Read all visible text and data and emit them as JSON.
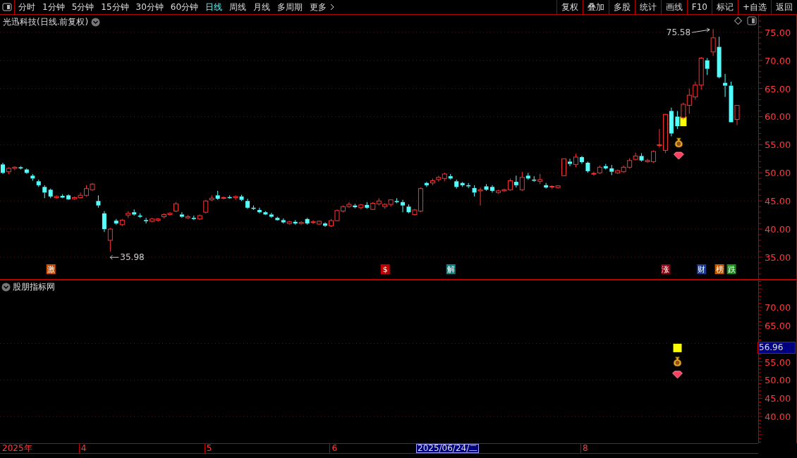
{
  "toolbar": {
    "periods": [
      {
        "label": "分时",
        "selected": false
      },
      {
        "label": "1分钟",
        "selected": false
      },
      {
        "label": "5分钟",
        "selected": false
      },
      {
        "label": "15分钟",
        "selected": false
      },
      {
        "label": "30分钟",
        "selected": false
      },
      {
        "label": "60分钟",
        "selected": false
      },
      {
        "label": "日线",
        "selected": true
      },
      {
        "label": "周线",
        "selected": false
      },
      {
        "label": "月线",
        "selected": false
      },
      {
        "label": "多周期",
        "selected": false
      },
      {
        "label": "更多",
        "selected": false
      }
    ],
    "buttons": [
      "复权",
      "叠加",
      "多股",
      "统计",
      "画线",
      "F10",
      "标记",
      "+自选",
      "返回"
    ]
  },
  "main_pane": {
    "title": "光迅科技(日线.前复权)",
    "event_tags": [
      {
        "color": "#c84a00"
      },
      {
        "color": "#c00000"
      },
      {
        "color": "#0a8080"
      },
      {
        "color": "#8a0010"
      },
      {
        "color": "#1a3a8a"
      },
      {
        "color": "#c05a00"
      },
      {
        "color": "#1a8a1a"
      }
    ],
    "chart_data": {
      "type": "candlestick",
      "grid": true,
      "ylim": [
        31,
        78.1
      ],
      "categories": [
        null,
        null,
        null,
        null,
        null,
        null,
        null,
        null,
        "激",
        null,
        null,
        null,
        null,
        null,
        null,
        null,
        null,
        null,
        null,
        null,
        null,
        null,
        null,
        null,
        null,
        null,
        null,
        null,
        null,
        null,
        null,
        null,
        null,
        null,
        null,
        null,
        null,
        null,
        null,
        null,
        null,
        null,
        null,
        null,
        null,
        null,
        null,
        null,
        null,
        null,
        null,
        null,
        null,
        null,
        null,
        null,
        null,
        null,
        null,
        null,
        null,
        null,
        null,
        null,
        "$",
        null,
        null,
        null,
        null,
        null,
        null,
        null,
        null,
        null,
        null,
        "解",
        null,
        null,
        null,
        null,
        null,
        null,
        null,
        null,
        null,
        null,
        null,
        null,
        null,
        null,
        null,
        null,
        null,
        null,
        null,
        null,
        null,
        null,
        null,
        null,
        null,
        null,
        null,
        null,
        null,
        null,
        null,
        null,
        null,
        null,
        null,
        "涨",
        null,
        null,
        null,
        null,
        null,
        "财",
        null,
        null,
        "榜",
        null,
        "跌",
        null
      ],
      "ohlc": [
        [
          51.5,
          51.8,
          49.8,
          50.0
        ],
        [
          50.2,
          51.0,
          49.8,
          50.8
        ],
        [
          50.8,
          51.2,
          50.5,
          51.0
        ],
        [
          51.0,
          51.2,
          50.6,
          50.8
        ],
        [
          50.6,
          50.8,
          49.8,
          50.0
        ],
        [
          49.5,
          49.8,
          48.6,
          49.0
        ],
        [
          48.5,
          48.8,
          47.5,
          47.8
        ],
        [
          47.5,
          47.8,
          45.5,
          46.5
        ],
        [
          47.0,
          47.2,
          45.5,
          45.8
        ],
        [
          45.6,
          46.0,
          45.4,
          45.8
        ],
        [
          45.9,
          46.2,
          45.5,
          45.6
        ],
        [
          46.0,
          46.2,
          45.2,
          45.3
        ],
        [
          45.4,
          45.8,
          45.2,
          45.6
        ],
        [
          45.6,
          46.5,
          45.5,
          46.0
        ],
        [
          46.0,
          47.8,
          45.8,
          47.2
        ],
        [
          47.0,
          48.2,
          46.8,
          48.0
        ],
        [
          45.0,
          46.0,
          43.8,
          44.2
        ],
        [
          42.8,
          43.2,
          39.5,
          40.0
        ],
        [
          38.0,
          40.2,
          35.98,
          40.0
        ],
        [
          41.5,
          41.8,
          40.8,
          41.0
        ],
        [
          40.8,
          41.8,
          40.5,
          41.6
        ],
        [
          42.5,
          43.2,
          42.0,
          42.8
        ],
        [
          43.0,
          43.5,
          42.4,
          42.6
        ],
        [
          42.4,
          42.8,
          42.0,
          42.2
        ],
        [
          41.6,
          42.0,
          41.0,
          41.4
        ],
        [
          41.4,
          42.0,
          41.2,
          41.8
        ],
        [
          41.6,
          42.0,
          41.3,
          41.8
        ],
        [
          42.2,
          42.8,
          42.0,
          42.6
        ],
        [
          42.6,
          43.0,
          42.4,
          42.8
        ],
        [
          43.2,
          44.8,
          43.0,
          44.5
        ],
        [
          42.6,
          43.0,
          42.0,
          42.2
        ],
        [
          42.0,
          42.5,
          41.8,
          42.2
        ],
        [
          42.0,
          42.4,
          41.6,
          41.8
        ],
        [
          41.8,
          42.6,
          41.6,
          42.4
        ],
        [
          43.0,
          45.2,
          42.8,
          45.0
        ],
        [
          45.2,
          46.0,
          45.0,
          45.5
        ],
        [
          46.0,
          46.8,
          45.2,
          45.4
        ],
        [
          45.5,
          45.8,
          45.3,
          45.6
        ],
        [
          45.7,
          46.0,
          45.4,
          45.5
        ],
        [
          45.6,
          46.0,
          45.2,
          45.8
        ],
        [
          45.8,
          46.1,
          45.0,
          45.2
        ],
        [
          45.0,
          45.4,
          43.6,
          43.8
        ],
        [
          43.8,
          44.2,
          43.4,
          43.6
        ],
        [
          43.4,
          43.8,
          42.8,
          43.0
        ],
        [
          43.0,
          43.2,
          42.5,
          42.6
        ],
        [
          42.6,
          42.9,
          42.0,
          42.2
        ],
        [
          42.0,
          42.2,
          41.5,
          41.6
        ],
        [
          41.6,
          41.9,
          41.0,
          41.2
        ],
        [
          41.0,
          41.5,
          40.8,
          41.3
        ],
        [
          41.3,
          41.6,
          40.8,
          41.0
        ],
        [
          41.0,
          41.4,
          40.8,
          41.2
        ],
        [
          41.8,
          42.0,
          40.8,
          41.0
        ],
        [
          41.2,
          41.6,
          40.9,
          41.3
        ],
        [
          40.9,
          41.5,
          40.8,
          41.4
        ],
        [
          41.0,
          41.2,
          40.4,
          40.6
        ],
        [
          40.6,
          41.8,
          40.4,
          41.5
        ],
        [
          41.5,
          43.5,
          41.4,
          43.3
        ],
        [
          43.2,
          44.2,
          43.0,
          44.0
        ],
        [
          44.0,
          44.8,
          43.8,
          44.4
        ],
        [
          44.2,
          44.5,
          43.7,
          43.9
        ],
        [
          43.8,
          44.5,
          43.5,
          44.3
        ],
        [
          44.3,
          44.8,
          43.6,
          43.8
        ],
        [
          43.5,
          44.8,
          43.4,
          44.6
        ],
        [
          44.5,
          45.5,
          44.2,
          45.0
        ],
        [
          44.0,
          44.6,
          43.6,
          44.4
        ],
        [
          44.4,
          45.3,
          44.0,
          45.2
        ],
        [
          45.0,
          45.5,
          44.6,
          44.8
        ],
        [
          44.8,
          45.2,
          43.0,
          44.2
        ],
        [
          44.0,
          44.4,
          42.8,
          43.0
        ],
        [
          42.6,
          43.6,
          42.4,
          43.4
        ],
        [
          43.2,
          47.4,
          43.0,
          47.2
        ],
        [
          48.2,
          48.4,
          47.5,
          47.8
        ],
        [
          48.2,
          49.0,
          47.8,
          48.6
        ],
        [
          48.8,
          49.5,
          48.4,
          49.2
        ],
        [
          49.0,
          50.0,
          48.5,
          49.8
        ],
        [
          49.4,
          49.8,
          48.8,
          49.0
        ],
        [
          48.5,
          48.8,
          47.2,
          47.5
        ],
        [
          48.2,
          48.4,
          47.5,
          47.8
        ],
        [
          47.8,
          48.2,
          47.3,
          47.6
        ],
        [
          47.3,
          47.8,
          45.8,
          46.5
        ],
        [
          46.8,
          47.4,
          44.2,
          47.0
        ],
        [
          47.6,
          48.0,
          46.8,
          47.0
        ],
        [
          47.5,
          47.8,
          46.5,
          46.8
        ],
        [
          46.5,
          47.0,
          46.3,
          46.8
        ],
        [
          46.8,
          47.2,
          46.6,
          47.0
        ],
        [
          47.0,
          49.0,
          46.8,
          48.6
        ],
        [
          48.4,
          49.5,
          47.4,
          47.8
        ],
        [
          47.0,
          50.2,
          46.8,
          49.2
        ],
        [
          49.5,
          50.0,
          48.8,
          49.0
        ],
        [
          48.8,
          49.4,
          48.4,
          48.6
        ],
        [
          48.5,
          49.8,
          48.0,
          48.8
        ],
        [
          47.8,
          48.2,
          47.2,
          47.4
        ],
        [
          47.5,
          47.8,
          47.2,
          47.6
        ],
        [
          47.4,
          47.8,
          47.2,
          47.7
        ],
        [
          49.5,
          52.5,
          49.4,
          52.5
        ],
        [
          52.0,
          52.5,
          51.2,
          51.6
        ],
        [
          51.5,
          53.4,
          51.0,
          52.8
        ],
        [
          52.8,
          53.0,
          51.6,
          51.9
        ],
        [
          51.8,
          52.0,
          50.0,
          50.3
        ],
        [
          49.8,
          50.2,
          49.5,
          49.9
        ],
        [
          50.0,
          51.3,
          49.8,
          51.0
        ],
        [
          51.2,
          51.6,
          50.6,
          50.8
        ],
        [
          50.8,
          51.4,
          49.6,
          50.2
        ],
        [
          50.0,
          50.6,
          49.8,
          50.4
        ],
        [
          50.2,
          51.3,
          50.0,
          51.0
        ],
        [
          51.0,
          52.6,
          50.8,
          52.2
        ],
        [
          52.4,
          53.6,
          52.2,
          53.0
        ],
        [
          53.0,
          53.5,
          52.0,
          52.2
        ],
        [
          52.0,
          52.5,
          51.8,
          52.2
        ],
        [
          52.0,
          54.0,
          51.8,
          53.8
        ],
        [
          54.9,
          57.8,
          54.5,
          55.0
        ],
        [
          54.0,
          60.5,
          53.5,
          60.4
        ],
        [
          61.0,
          61.6,
          56.5,
          57.0
        ],
        [
          60.0,
          61.0,
          57.8,
          58.3
        ],
        [
          59.8,
          62.5,
          59.5,
          62.2
        ],
        [
          62.0,
          65.0,
          60.5,
          63.8
        ],
        [
          63.5,
          66.2,
          63.0,
          65.6
        ],
        [
          65.6,
          70.6,
          64.8,
          70.4
        ],
        [
          70.0,
          70.4,
          67.4,
          68.5
        ],
        [
          71.5,
          75.58,
          70.8,
          74.0
        ],
        [
          72.4,
          74.2,
          66.8,
          67.0
        ],
        [
          66.0,
          67.6,
          63.5,
          65.5
        ],
        [
          65.5,
          66.2,
          59.0,
          59.0
        ],
        [
          59.5,
          62.0,
          58.5,
          62.0
        ]
      ],
      "yticks": [
        {
          "value": 35,
          "label": "35.00"
        },
        {
          "value": 40,
          "label": "40.00"
        },
        {
          "value": 45,
          "label": "45.00"
        },
        {
          "value": 50,
          "label": "50.00"
        },
        {
          "value": 55,
          "label": "55.00"
        },
        {
          "value": 60,
          "label": "60.00"
        },
        {
          "value": 65,
          "label": "65.00"
        },
        {
          "value": 70,
          "label": "70.00"
        },
        {
          "value": 75,
          "label": "75.00"
        }
      ],
      "annotations": [
        {
          "text": "35.98"
        },
        {
          "text": "75.58"
        }
      ]
    }
  },
  "indicator_pane": {
    "title": "股朋指标网",
    "current_value": "56.96",
    "year_label": "2025年",
    "chart_data": {
      "type": "scatter",
      "xlim": [
        3.337,
        9.384
      ],
      "ylim": [
        32.7,
        77.5
      ],
      "x": [
        8.74
      ],
      "series": [
        {
          "color": "#ffff00",
          "values": [
            58.8
          ]
        }
      ],
      "xticks": [
        {
          "value": 4,
          "label": "4"
        },
        {
          "value": 5,
          "label": "5"
        },
        {
          "value": 6,
          "label": "6"
        },
        {
          "value": 8,
          "label": "8"
        }
      ],
      "yticks": [
        {
          "value": 40,
          "label": "40.00"
        },
        {
          "value": 45,
          "label": "45.00"
        },
        {
          "value": 50,
          "label": "50.00"
        },
        {
          "value": 55,
          "label": "55.00"
        },
        {
          "value": 65,
          "label": "65.00"
        },
        {
          "value": 70,
          "label": "70.00"
        }
      ],
      "annotations": [
        {
          "text": "2025/06/24/二"
        }
      ]
    }
  }
}
